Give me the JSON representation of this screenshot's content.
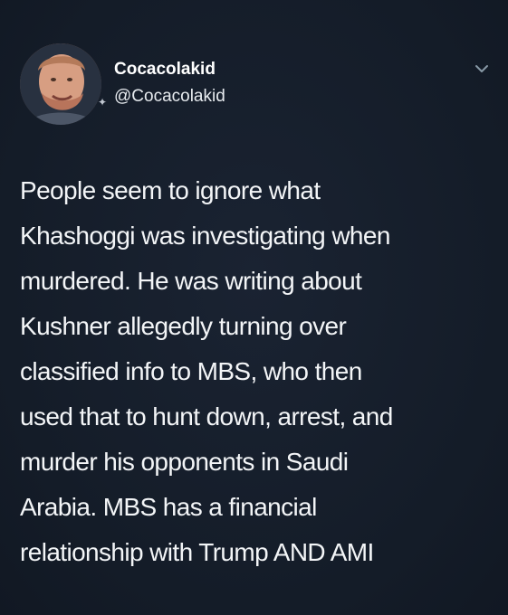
{
  "author": {
    "display_name": "Cocacolakid",
    "handle": "@Cocacolakid"
  },
  "tweet": {
    "text": "People seem to ignore what\nKhashoggi was investigating when\nmurdered. He was writing about\nKushner allegedly turning over\nclassified info to MBS, who then\nused that to hunt down, arrest, and\nmurder his opponents in Saudi\nArabia. MBS has a financial\nrelationship with Trump AND AMI"
  },
  "icons": {
    "menu": "chevron-down-icon",
    "avatar": "avatar"
  },
  "colors": {
    "background": "#15202b",
    "text": "#f3f5f7",
    "name": "#ffffff"
  }
}
